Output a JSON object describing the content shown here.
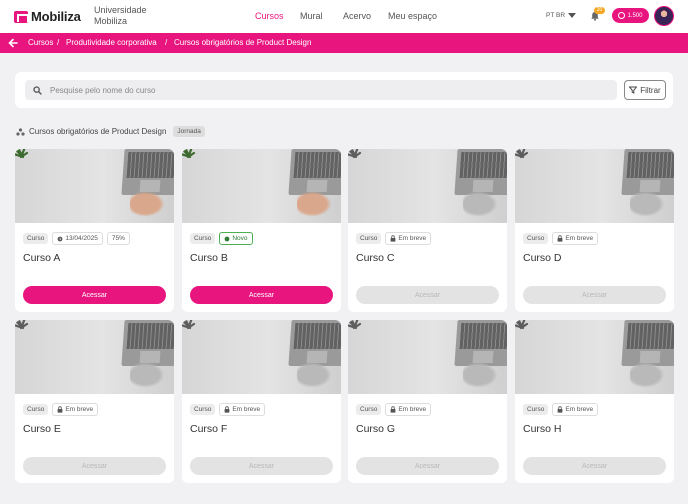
{
  "header": {
    "logo_text": "Mobiliza",
    "org_line1": "Universidade",
    "org_line2": "Mobiliza",
    "nav": [
      "Cursos",
      "Mural",
      "Acervo",
      "Meu espaço"
    ],
    "active_nav": "Cursos",
    "lang": "PT BR",
    "notification_count": "20",
    "points": "1.500"
  },
  "breadcrumb": [
    "Cursos",
    "Produtividade corporativa",
    "Cursos obrigatórios de Product Design"
  ],
  "search": {
    "placeholder": "Pesquise pelo nome do curso",
    "filter_label": "Filtrar"
  },
  "section": {
    "title": "Cursos obrigatórios de Product Design",
    "tag": "Jornada"
  },
  "labels": {
    "course_chip": "Curso",
    "new_chip": "Novo",
    "soon_chip": "Em breve",
    "access": "Acessar"
  },
  "colors": {
    "accent": "#e8157f",
    "new_green": "#4caf50"
  },
  "cards": [
    {
      "title": "Curso A",
      "status": "progress",
      "date": "13/04/2025",
      "progress": "75%",
      "enabled": true
    },
    {
      "title": "Curso B",
      "status": "new",
      "enabled": true
    },
    {
      "title": "Curso C",
      "status": "soon",
      "enabled": false
    },
    {
      "title": "Curso D",
      "status": "soon",
      "enabled": false
    },
    {
      "title": "Curso E",
      "status": "soon",
      "enabled": false
    },
    {
      "title": "Curso F",
      "status": "soon",
      "enabled": false
    },
    {
      "title": "Curso G",
      "status": "soon",
      "enabled": false
    },
    {
      "title": "Curso H",
      "status": "soon",
      "enabled": false
    }
  ]
}
